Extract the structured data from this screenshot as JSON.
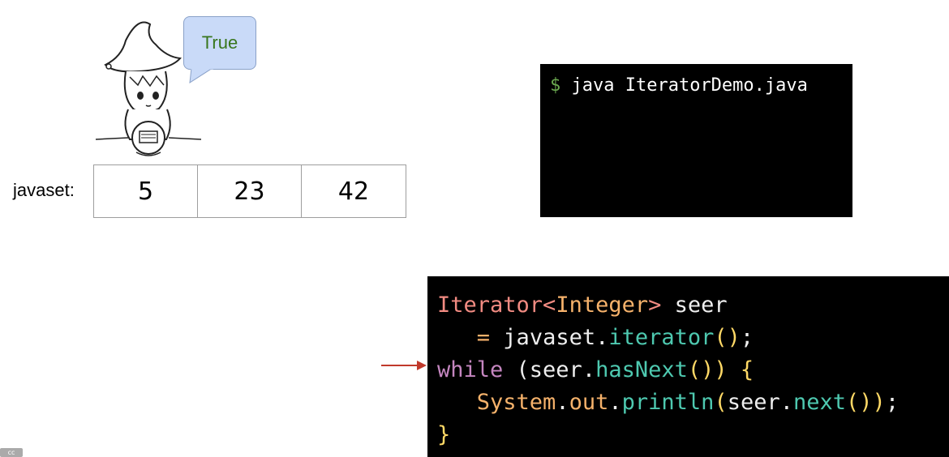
{
  "speech_bubble": {
    "text": "True",
    "text_color": "#38761d",
    "fill": "#c9daf8"
  },
  "set": {
    "label": "javaset:",
    "values": [
      "5",
      "23",
      "42"
    ]
  },
  "terminal": {
    "prompt": "$",
    "command": "java IteratorDemo.java"
  },
  "code": {
    "colors": {
      "keyword": "#c586c0",
      "type": "#f28b82",
      "class": "#f6b26b",
      "method": "#4ec9b0",
      "punct": "#ffd966",
      "plain": "#eeeeee",
      "op": "#f6b26b"
    },
    "lines": [
      [
        {
          "t": "Iterator",
          "c": "type"
        },
        {
          "t": "<",
          "c": "type"
        },
        {
          "t": "Integer",
          "c": "class"
        },
        {
          "t": ">",
          "c": "type"
        },
        {
          "t": " seer",
          "c": "plain"
        }
      ],
      [
        {
          "t": "   ",
          "c": "plain"
        },
        {
          "t": "=",
          "c": "op"
        },
        {
          "t": " javaset",
          "c": "plain"
        },
        {
          "t": ".",
          "c": "plain"
        },
        {
          "t": "iterator",
          "c": "method"
        },
        {
          "t": "()",
          "c": "punct"
        },
        {
          "t": ";",
          "c": "plain"
        }
      ],
      [
        {
          "t": "while",
          "c": "keyword"
        },
        {
          "t": " (seer",
          "c": "plain"
        },
        {
          "t": ".",
          "c": "plain"
        },
        {
          "t": "hasNext",
          "c": "method"
        },
        {
          "t": "())",
          "c": "punct"
        },
        {
          "t": " {",
          "c": "punct"
        }
      ],
      [
        {
          "t": "   ",
          "c": "plain"
        },
        {
          "t": "System",
          "c": "class"
        },
        {
          "t": ".",
          "c": "plain"
        },
        {
          "t": "out",
          "c": "class"
        },
        {
          "t": ".",
          "c": "plain"
        },
        {
          "t": "println",
          "c": "method"
        },
        {
          "t": "(",
          "c": "punct"
        },
        {
          "t": "seer",
          "c": "plain"
        },
        {
          "t": ".",
          "c": "plain"
        },
        {
          "t": "next",
          "c": "method"
        },
        {
          "t": "())",
          "c": "punct"
        },
        {
          "t": ";",
          "c": "plain"
        }
      ],
      [
        {
          "t": "}",
          "c": "punct"
        }
      ]
    ],
    "current_line": 3
  },
  "arrow_color": "#c0392b"
}
